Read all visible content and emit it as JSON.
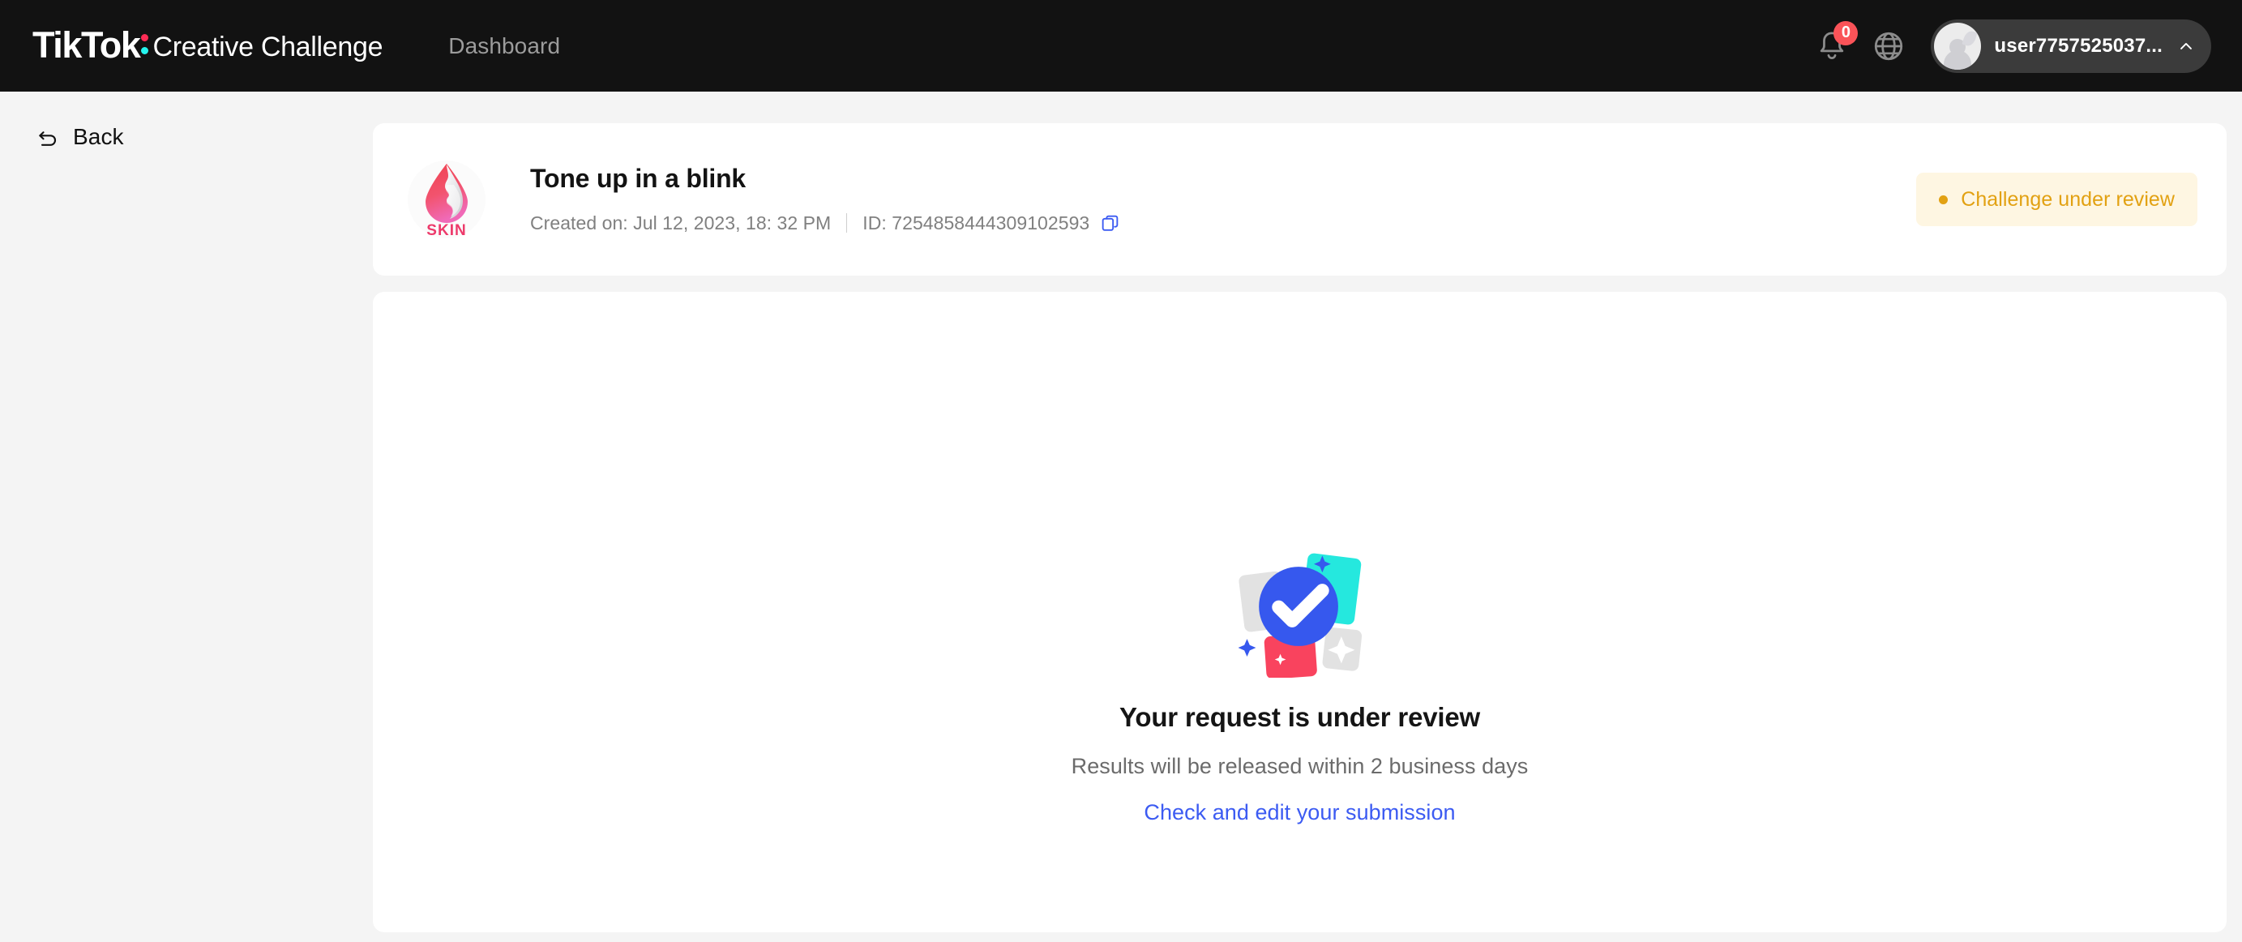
{
  "header": {
    "logo_text": "TikTok",
    "logo_suffix": "Creative Challenge",
    "nav": [
      {
        "label": "Dashboard"
      }
    ],
    "notification_count": "0",
    "notification_icon": "bell-icon",
    "language_icon": "globe-icon",
    "user": {
      "name": "user7757525037...",
      "chevron_icon": "chevron-up-icon",
      "avatar_icon": "avatar"
    }
  },
  "sidebar": {
    "back": {
      "label": "Back",
      "icon": "back-arrow-icon"
    }
  },
  "challenge": {
    "brand_logo_text": "SKIN",
    "title": "Tone up in a blink",
    "created_label": "Created on: Jul 12, 2023, 18: 32 PM",
    "id_label": "ID: 7254858444309102593",
    "copy_icon": "copy-icon",
    "status": {
      "label": "Challenge under review",
      "bg_color": "#FEF6E2",
      "text_color": "#E2A112"
    }
  },
  "empty_state": {
    "illustration_icon": "check-circle-cards-illustration",
    "title": "Your request is under review",
    "subtitle": "Results will be released within 2 business days",
    "link_label": "Check and edit your submission",
    "link_color": "#3C5BF2"
  }
}
